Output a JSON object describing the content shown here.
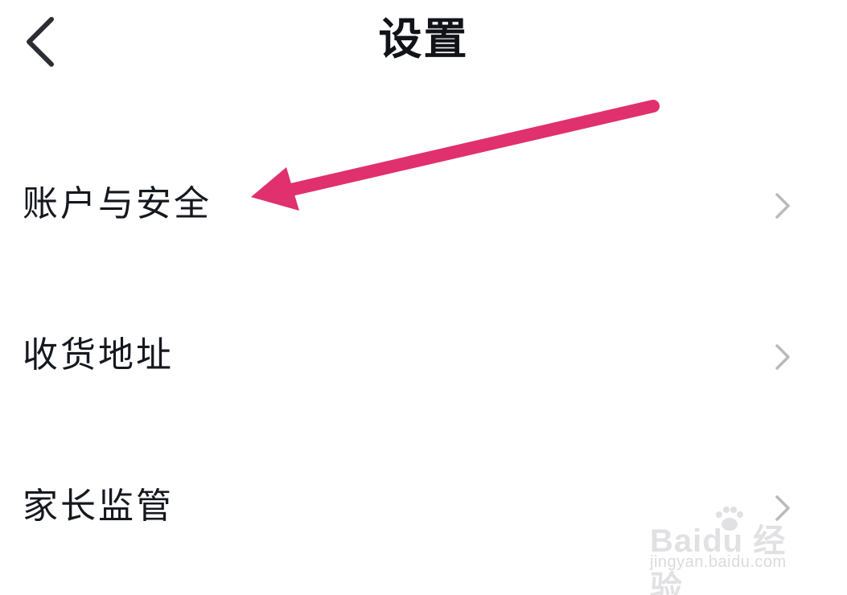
{
  "header": {
    "back_icon": "chevron-left-icon",
    "title": "设置"
  },
  "menu": {
    "items": [
      {
        "label": "账户与安全",
        "icon": "chevron-right-icon"
      },
      {
        "label": "收货地址",
        "icon": "chevron-right-icon"
      },
      {
        "label": "家长监管",
        "icon": "chevron-right-icon"
      }
    ]
  },
  "annotation": {
    "arrow_color": "#e0306e"
  },
  "watermark": {
    "logo_text": "Baidu 经验",
    "url_text": "jingyan.baidu.com"
  },
  "colors": {
    "text": "#16181f",
    "chevron": "#b8babf",
    "background": "#ffffff"
  }
}
